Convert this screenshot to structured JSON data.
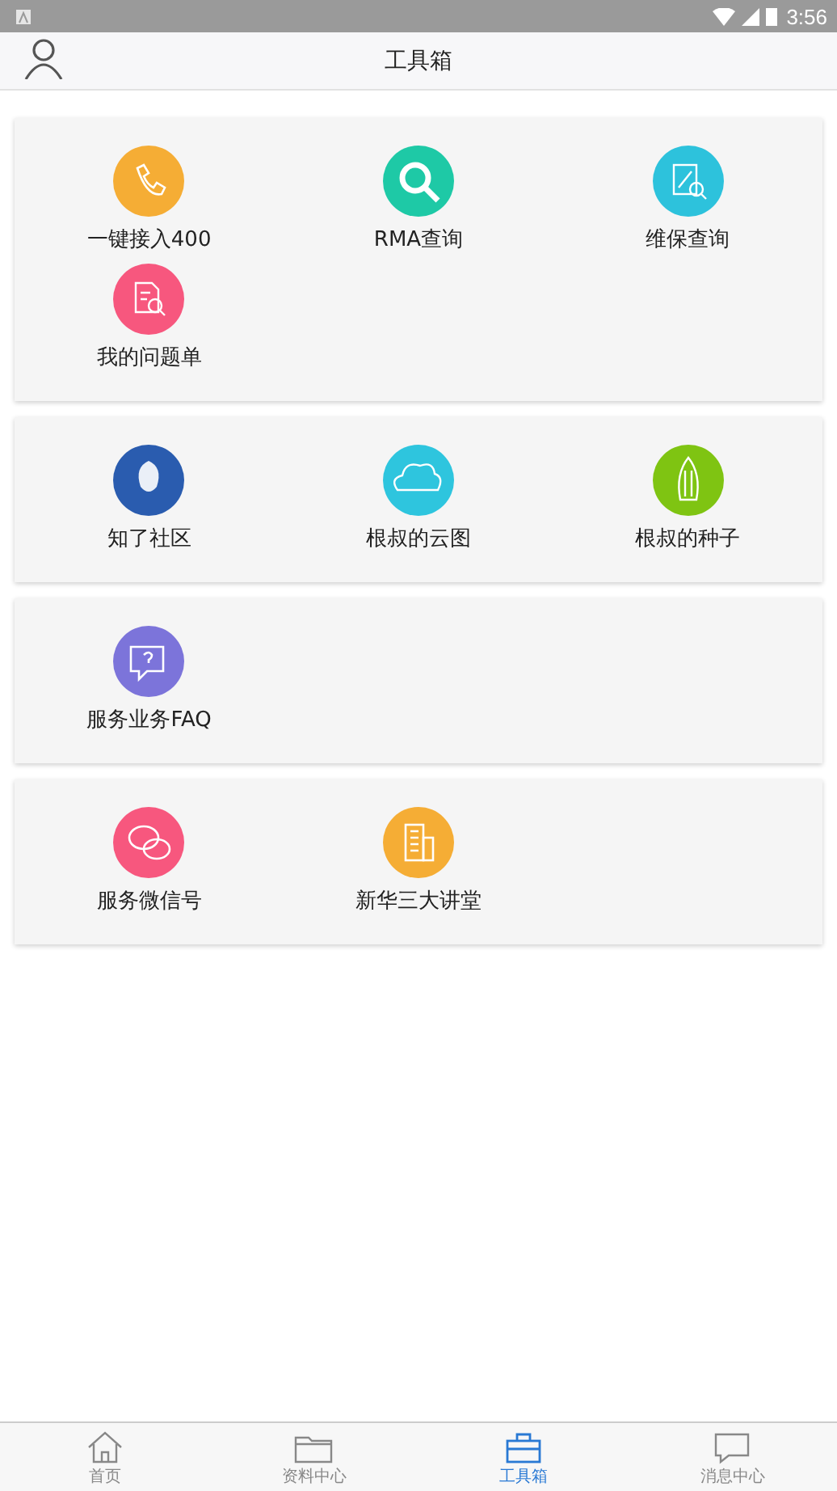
{
  "status_bar": {
    "time": "3:56"
  },
  "header": {
    "title": "工具箱"
  },
  "cards": [
    {
      "items": [
        {
          "kind": "phone",
          "label": "一键接入400",
          "color": "#f5ad35"
        },
        {
          "kind": "search",
          "label": "RMA查询",
          "color": "#1ec9a6"
        },
        {
          "kind": "repair",
          "label": "维保查询",
          "color": "#2dc2dc"
        },
        {
          "kind": "ticket",
          "label": "我的问题单",
          "color": "#f7577e"
        }
      ]
    },
    {
      "items": [
        {
          "kind": "community",
          "label": "知了社区",
          "color": "#2a5caf"
        },
        {
          "kind": "cloud",
          "label": "根叔的云图",
          "color": "#2ec5de"
        },
        {
          "kind": "seed",
          "label": "根叔的种子",
          "color": "#7fc412"
        }
      ]
    },
    {
      "items": [
        {
          "kind": "faq",
          "label": "服务业务FAQ",
          "color": "#7c74da"
        }
      ]
    },
    {
      "items": [
        {
          "kind": "wechat",
          "label": "服务微信号",
          "color": "#f7577e"
        },
        {
          "kind": "building",
          "label": "新华三大讲堂",
          "color": "#f5ad35"
        }
      ]
    }
  ],
  "nav": [
    {
      "kind": "home",
      "label": "首页",
      "selected": false
    },
    {
      "kind": "folder",
      "label": "资料中心",
      "selected": false
    },
    {
      "kind": "toolbox",
      "label": "工具箱",
      "selected": true
    },
    {
      "kind": "message",
      "label": "消息中心",
      "selected": false
    }
  ]
}
